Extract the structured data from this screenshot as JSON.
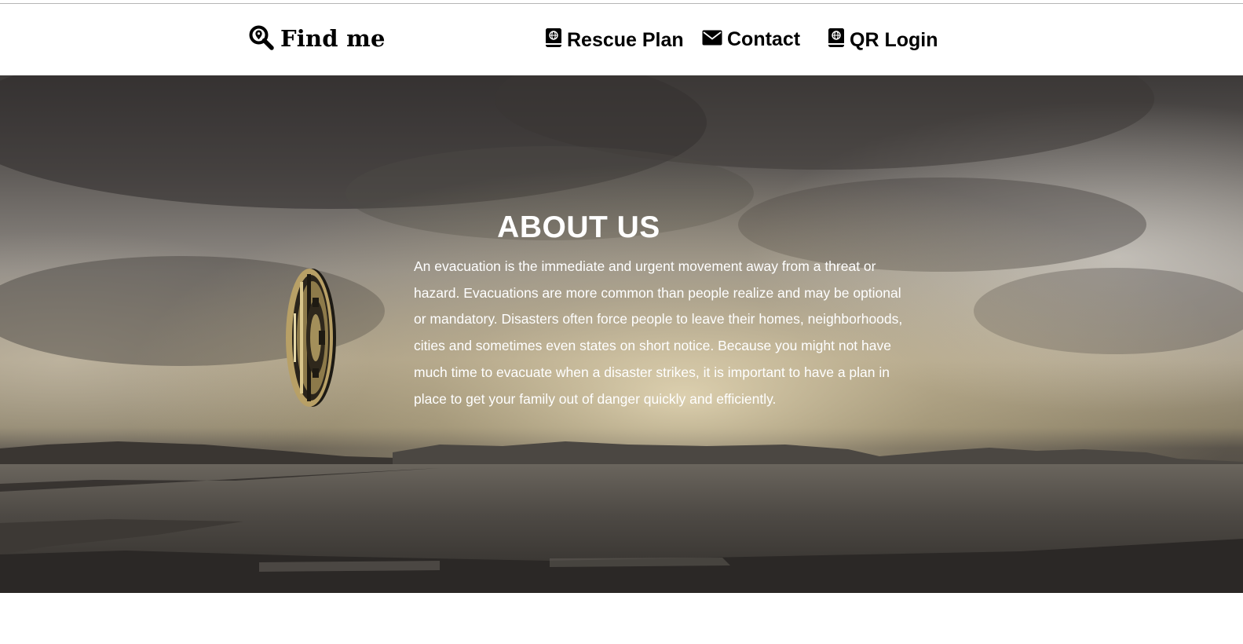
{
  "navbar": {
    "brand": {
      "label": "Find me",
      "icon": "search-location-icon"
    },
    "items": [
      {
        "label": "Rescue Plan",
        "icon": "atlas-book-icon"
      },
      {
        "label": "Contact",
        "icon": "envelope-icon"
      },
      {
        "label": "QR Login",
        "icon": "atlas-book-icon"
      }
    ]
  },
  "hero": {
    "title": "ABOUT US",
    "body": "An evacuation is the immediate and urgent movement away from a threat or hazard. Evacuations are more common than people realize and may be optional or mandatory. Disasters often force people to leave their homes, neighborhoods, cities and sometimes even states on short notice. Because you might not have much time to evacuate when a disaster strikes, it is important to have a plan in place to get your family out of danger quickly and efficiently.",
    "image": "cloudy-sky-over-sea-landscape"
  },
  "colors": {
    "nav_background": "#ffffff",
    "nav_text": "#000000",
    "hero_text": "#ffffff",
    "coin_gold": "#b8a066"
  }
}
